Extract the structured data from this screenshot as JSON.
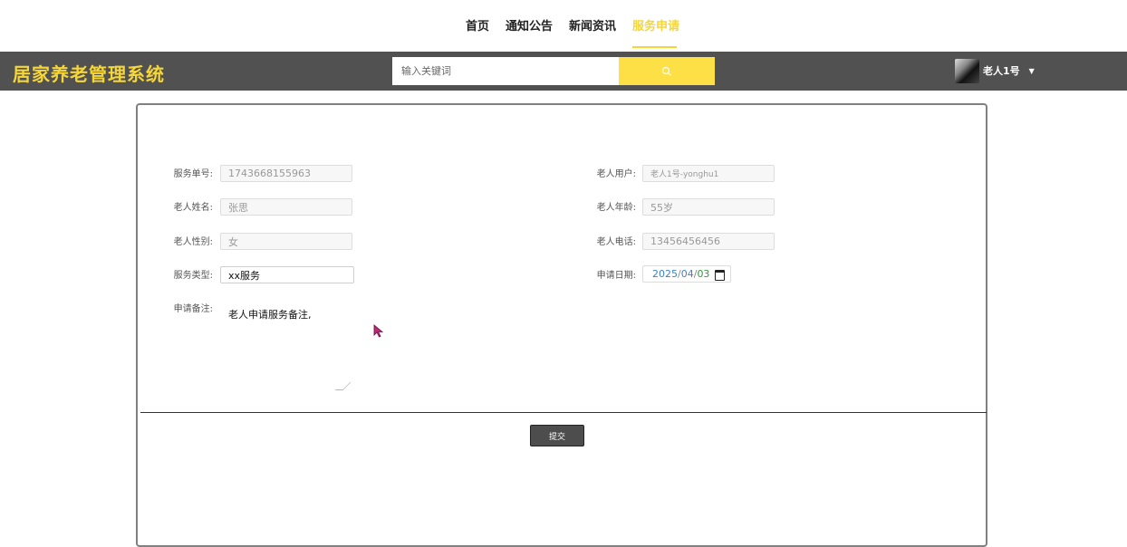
{
  "nav": {
    "items": [
      {
        "label": "首页"
      },
      {
        "label": "通知公告"
      },
      {
        "label": "新闻资讯"
      },
      {
        "label": "服务申请",
        "active": true
      }
    ]
  },
  "header": {
    "brand": "居家养老管理系统",
    "search_placeholder": "输入关键词",
    "search_icon": "search-icon",
    "user_name": "老人1号"
  },
  "form": {
    "service_no": {
      "label": "服务单号:",
      "value": "1743668155963"
    },
    "elder_user": {
      "label": "老人用户:",
      "value": "老人1号-yonghu1"
    },
    "elder_name": {
      "label": "老人姓名:",
      "value": "张思"
    },
    "elder_age": {
      "label": "老人年龄:",
      "value": "55岁"
    },
    "elder_gender": {
      "label": "老人性别:",
      "value": "女"
    },
    "elder_phone": {
      "label": "老人电话:",
      "value": "13456456456"
    },
    "service_type": {
      "label": "服务类型:",
      "value": "xx服务"
    },
    "apply_date": {
      "label": "申请日期:",
      "year": "2025",
      "month": "04",
      "day": "03"
    },
    "remark": {
      "label": "申请备注:",
      "value": "老人申请服务备注,"
    },
    "submit_label": "提交"
  },
  "colors": {
    "accent": "#f5d63a",
    "header_bg": "#515151",
    "search_button": "#fde046"
  }
}
